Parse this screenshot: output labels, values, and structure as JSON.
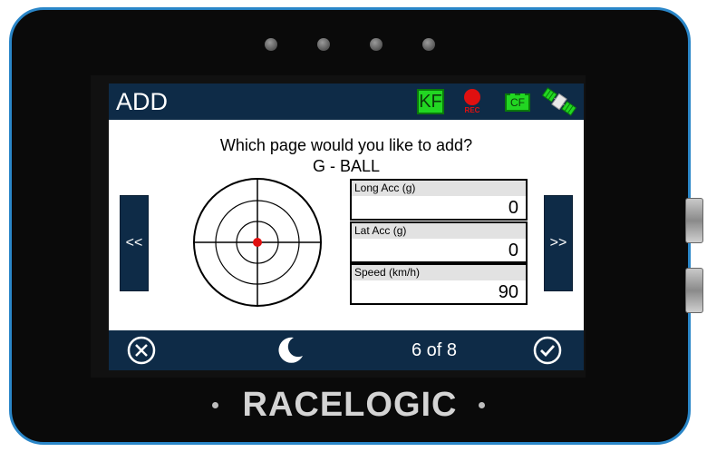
{
  "device": {
    "brand": "RACELOGIC"
  },
  "topbar": {
    "title": "ADD",
    "kf_label": "KF",
    "rec_label": "REC",
    "cf_label": "CF",
    "icons": [
      "kf-status-icon",
      "record-icon",
      "cf-card-icon",
      "satellite-icon"
    ]
  },
  "main": {
    "question": "Which page would you like to add?",
    "page_name": "G - BALL",
    "prev_label": "<<",
    "next_label": ">>",
    "gball": {
      "dot_x": 0,
      "dot_y": 0
    },
    "panels": [
      {
        "label": "Long Acc (g)",
        "value": "0"
      },
      {
        "label": "Lat Acc (g)",
        "value": "0"
      },
      {
        "label": "Speed (km/h)",
        "value": "90"
      }
    ]
  },
  "bottombar": {
    "page_indicator": "6 of 8",
    "icons": [
      "cancel-icon",
      "night-mode-icon",
      "confirm-icon"
    ]
  },
  "colors": {
    "bar": "#0e2b47",
    "bezel": "#0a0a0a",
    "frame": "#2a86c8",
    "status_green": "#22d622",
    "record_red": "#e01010",
    "gball_dot": "#e01010"
  }
}
